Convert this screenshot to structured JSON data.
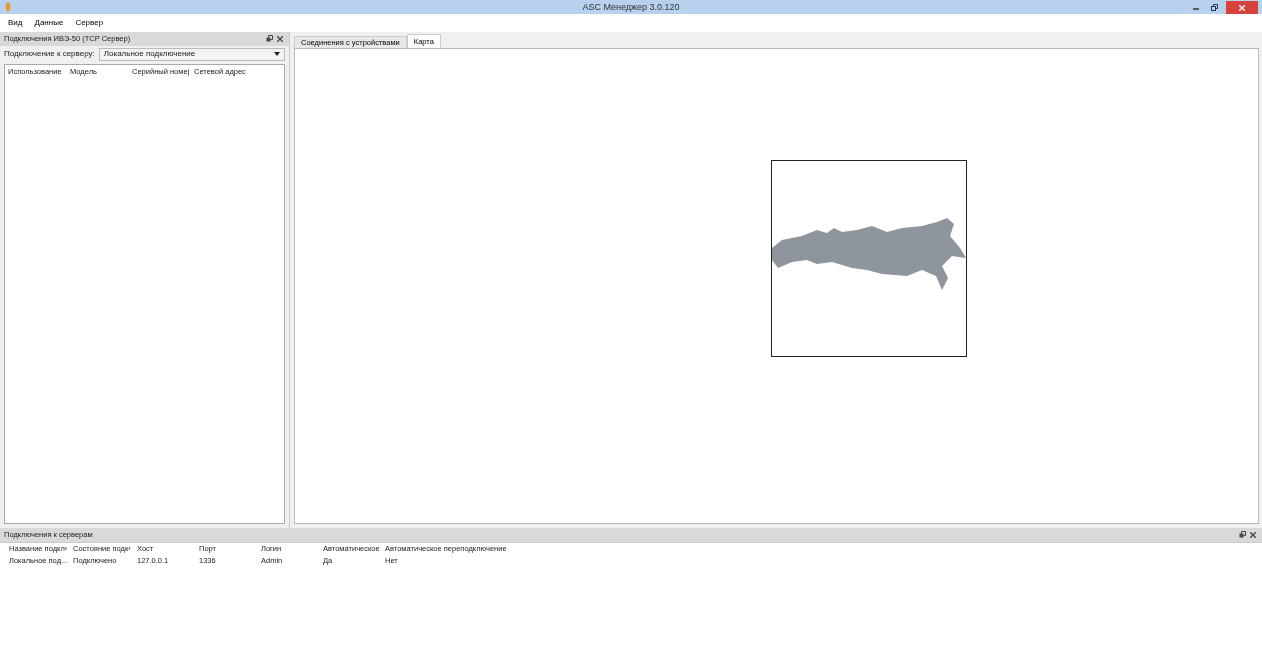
{
  "window": {
    "title": "ASC Менеджер 3.0.120"
  },
  "menu": [
    "Вид",
    "Данные",
    "Сервер"
  ],
  "left_panel": {
    "title": "Подключения ИВЭ-50 (TCP Сервер)",
    "server_label": "Подключение к серверу:",
    "server_value": "Локальное подключение",
    "columns": [
      "Использование",
      "Модель",
      "Серийный номе|",
      "Сетевой адрес"
    ]
  },
  "tabs": [
    {
      "label": "Соединения с устройствами",
      "selected": false
    },
    {
      "label": "Карта",
      "selected": true
    }
  ],
  "bottom_panel": {
    "title": "Подключения к серверам",
    "columns": [
      "Название подкл‹",
      "Состояние подк‹",
      "Хост",
      "Порт",
      "Логин",
      "Автоматическое",
      "Автоматическое переподключение"
    ],
    "rows": [
      [
        "Локальное под...",
        "Подключено",
        "127.0.0.1",
        "1336",
        "Admin",
        "Да",
        "Нет"
      ]
    ]
  }
}
